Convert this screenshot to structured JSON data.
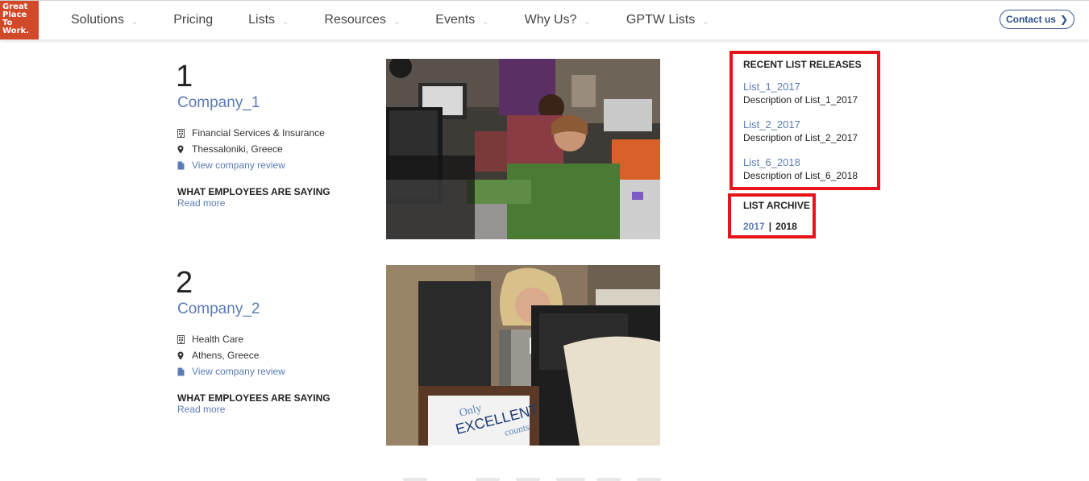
{
  "header": {
    "logo_lines": [
      "Great",
      "Place",
      "To",
      "Work."
    ],
    "nav": [
      {
        "label": "Solutions",
        "has_dropdown": true
      },
      {
        "label": "Pricing",
        "has_dropdown": false
      },
      {
        "label": "Lists",
        "has_dropdown": true
      },
      {
        "label": "Resources",
        "has_dropdown": true
      },
      {
        "label": "Events",
        "has_dropdown": true
      },
      {
        "label": "Why Us?",
        "has_dropdown": true
      },
      {
        "label": "GPTW Lists",
        "has_dropdown": true
      }
    ],
    "contact_label": "Contact us"
  },
  "companies": [
    {
      "rank": "1",
      "name": "Company_1",
      "industry": "Financial Services & Insurance",
      "location": "Thessaloniki, Greece",
      "review_link": "View company review",
      "saying_heading": "WHAT EMPLOYEES ARE SAYING",
      "read_more": "Read more"
    },
    {
      "rank": "2",
      "name": "Company_2",
      "industry": "Health Care",
      "location": "Athens, Greece",
      "review_link": "View company review",
      "saying_heading": "WHAT EMPLOYEES ARE SAYING",
      "read_more": "Read more"
    }
  ],
  "photo2_sign": {
    "line1": "Only",
    "line2": "EXCELLENT",
    "line3": "counts"
  },
  "sidebar": {
    "recent_title": "RECENT LIST RELEASES",
    "releases": [
      {
        "name": "List_1_2017",
        "description": "Description of List_1_2017"
      },
      {
        "name": "List_2_2017",
        "description": "Description of List_2_2017"
      },
      {
        "name": "List_6_2018",
        "description": "Description of List_6_2018"
      }
    ],
    "archive_title": "LIST ARCHIVE",
    "archive_years": [
      "2017",
      "2018"
    ],
    "archive_separator": "|"
  },
  "colors": {
    "brand": "#d2492a",
    "link": "#5b7bb5",
    "highlight": "#e8141b"
  }
}
